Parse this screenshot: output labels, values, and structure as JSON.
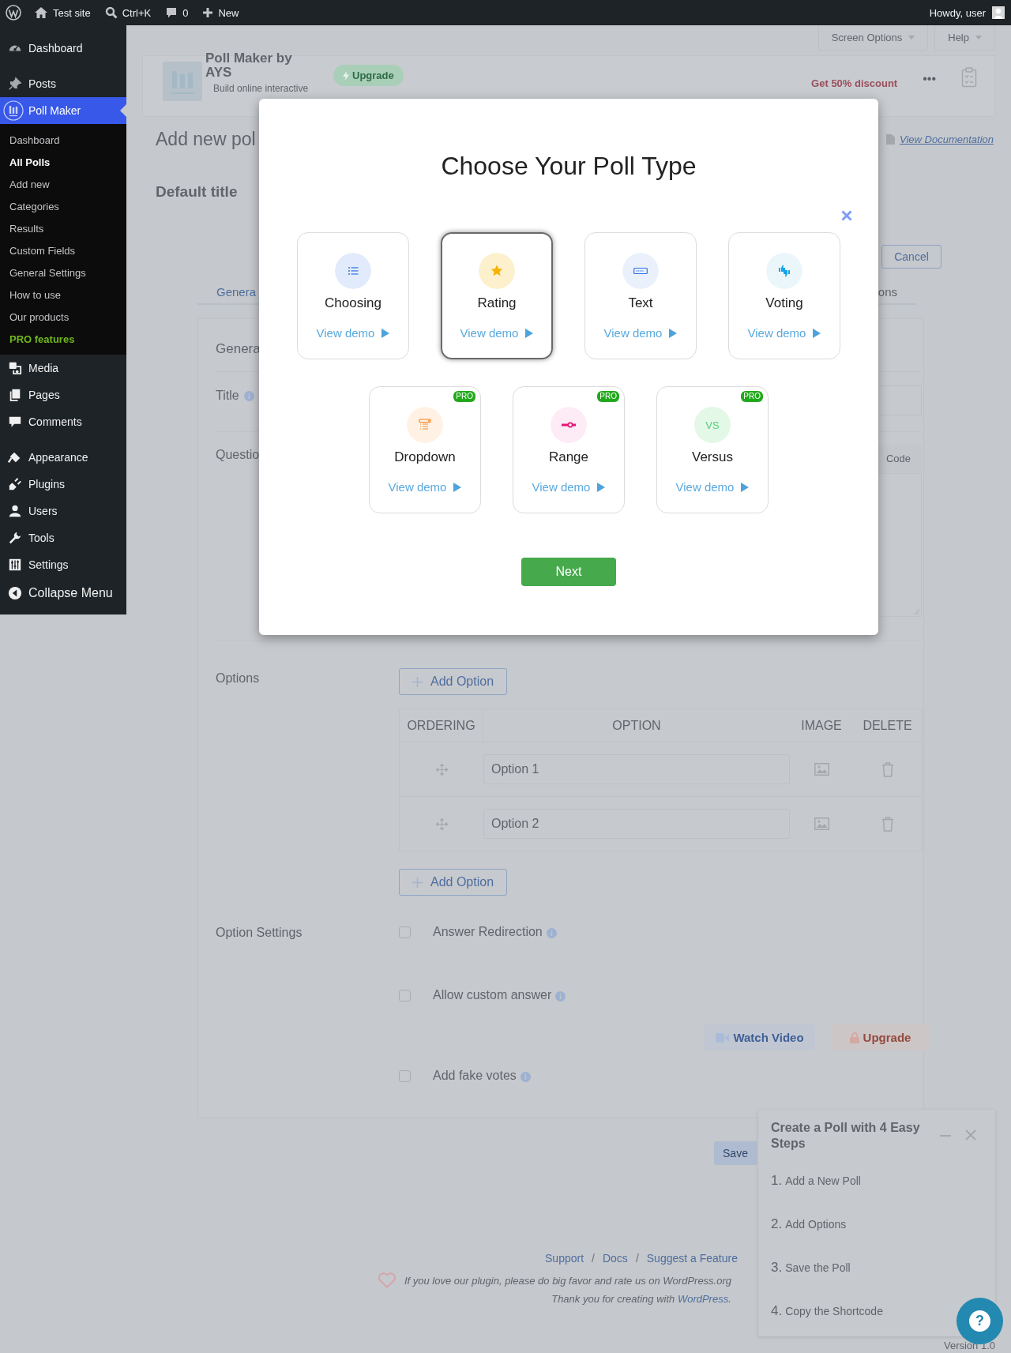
{
  "admin_bar": {
    "site": "Test site",
    "search": "Ctrl+K",
    "comments": "0",
    "new": "New",
    "greeting": "Howdy, user"
  },
  "sidebar": {
    "groups": [
      [
        {
          "label": "Dashboard",
          "selected": false
        }
      ],
      [
        {
          "label": "Posts",
          "selected": false
        },
        {
          "label": "Poll Maker",
          "selected": true,
          "submenu": [
            {
              "label": "Dashboard",
              "selected": false,
              "kind": "link"
            },
            {
              "label": "All Polls",
              "selected": true,
              "kind": "link"
            },
            {
              "label": "Add new",
              "selected": false,
              "kind": "link"
            },
            {
              "label": "Categories",
              "selected": false,
              "kind": "link"
            },
            {
              "label": "Results",
              "selected": false,
              "kind": "link"
            },
            {
              "label": "Custom Fields",
              "selected": false,
              "kind": "link"
            },
            {
              "label": "General Settings",
              "selected": false,
              "kind": "link"
            },
            {
              "label": "How to use",
              "selected": false,
              "kind": "link"
            },
            {
              "label": "Our products",
              "selected": false,
              "kind": "link"
            },
            {
              "label": "PRO features",
              "selected": false,
              "kind": "pro"
            }
          ]
        },
        {
          "label": "Media",
          "selected": false
        },
        {
          "label": "Pages",
          "selected": false
        },
        {
          "label": "Comments",
          "selected": false
        }
      ],
      [
        {
          "label": "Appearance",
          "selected": false
        },
        {
          "label": "Plugins",
          "selected": false
        },
        {
          "label": "Users",
          "selected": false
        },
        {
          "label": "Tools",
          "selected": false
        },
        {
          "label": "Settings",
          "selected": false
        }
      ]
    ],
    "collapse": "Collapse Menu"
  },
  "page": {
    "screen_options": "Screen Options",
    "help": "Help",
    "plugin": {
      "name": "Poll Maker by AYS",
      "tagline": "Build online interactive",
      "upgrade": "Upgrade",
      "discount": "Get 50% discount",
      "more": "•••"
    },
    "heading": "Add new pol",
    "documentation": "View Documentation",
    "poll_title": "Default title",
    "cancel": "Cancel",
    "tabs": [
      {
        "label": "Genera",
        "selected": true
      },
      {
        "label": "ons",
        "selected": false
      }
    ],
    "form": {
      "section": "Genera",
      "title_label": "Title",
      "question_label": "Questio",
      "editor_tab": "Code",
      "options_label": "Options",
      "add_option_top": "Add Option",
      "add_option_bottom": "Add Option",
      "table": {
        "columns": [
          "ORDERING",
          "OPTION",
          "IMAGE",
          "DELETE"
        ],
        "rows": [
          {
            "option": "Option 1"
          },
          {
            "option": "Option 2"
          }
        ]
      },
      "settings_label": "Option Settings",
      "settings": [
        {
          "label": "Answer Redirection",
          "checked": false
        },
        {
          "label": "Allow custom answer",
          "checked": false
        },
        {
          "label": "Add fake votes",
          "checked": false
        }
      ],
      "watch_video": "Watch Video",
      "upgrade": "Upgrade"
    },
    "save": "Save",
    "footer": {
      "items": [
        {
          "kind": "link",
          "text": "Support"
        },
        {
          "kind": "separator",
          "text": "/"
        },
        {
          "kind": "link",
          "text": "Docs"
        },
        {
          "kind": "separator",
          "text": "/"
        },
        {
          "kind": "link",
          "text": "Suggest a Feature"
        }
      ],
      "rate_text": "If you love our plugin, please do big favor and rate us on WordPress.org",
      "thanks_prefix": "Thank you for creating with",
      "thanks_link": "WordPress",
      "thanks_suffix": ".",
      "version": "Version 1.0"
    }
  },
  "steps_panel": {
    "title": "Create a Poll with 4 Easy Steps",
    "steps": [
      {
        "number": "1.",
        "text": "Add a New Poll"
      },
      {
        "number": "2.",
        "text": "Add Options"
      },
      {
        "number": "3.",
        "text": "Save the Poll"
      },
      {
        "number": "4.",
        "text": "Copy the Shortcode"
      }
    ]
  },
  "modal": {
    "title": "Choose Your Poll Type",
    "poll_types": [
      {
        "name": "Choosing",
        "demo": "View demo",
        "selected": false
      },
      {
        "name": "Rating",
        "demo": "View demo",
        "selected": true
      },
      {
        "name": "Text",
        "demo": "View demo",
        "selected": false
      },
      {
        "name": "Voting",
        "demo": "View demo",
        "selected": false
      },
      {
        "name": "Dropdown",
        "demo": "View demo",
        "selected": false,
        "badge": "PRO"
      },
      {
        "name": "Range",
        "demo": "View demo",
        "selected": false,
        "badge": "PRO"
      },
      {
        "name": "Versus",
        "demo": "View demo",
        "selected": false,
        "badge": "PRO",
        "icon_text": "VS"
      }
    ],
    "next": "Next"
  },
  "help_button": "?"
}
